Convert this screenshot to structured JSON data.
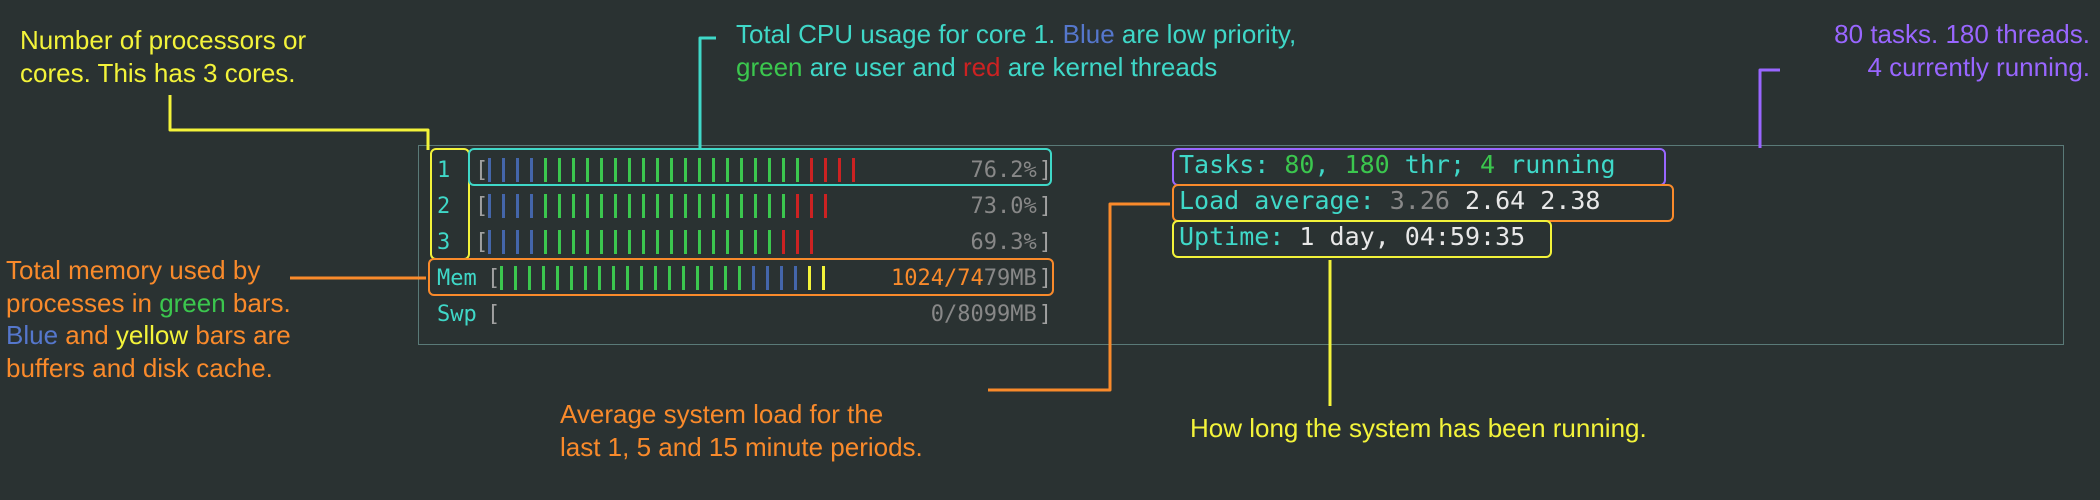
{
  "annotations": {
    "cores": {
      "line1": "Number of processors or",
      "line2": "cores. This has 3 cores."
    },
    "cpu": {
      "line1_a": "Total CPU usage for core 1. ",
      "line1_blue": "Blue",
      "line1_b": " are low priority,",
      "line2_green": "green",
      "line2_a": " are user and ",
      "line2_red": "red",
      "line2_b": " are kernel threads"
    },
    "tasks": {
      "line1": "80 tasks. 180 threads.",
      "line2": "4 currently running."
    },
    "mem": {
      "line1_a": "Total memory used by",
      "line2_a": "processes in ",
      "line2_green": "green",
      "line2_b": " bars.",
      "line3_blue": "Blue",
      "line3_a": " and ",
      "line3_yellow": "yellow",
      "line3_b": " bars are",
      "line4": "buffers  and disk cache."
    },
    "load": {
      "line1": "Average system load for the",
      "line2": "last 1, 5 and 15 minute periods."
    },
    "uptime": {
      "line1": "How long the system has been running."
    }
  },
  "cpu": [
    {
      "label": "1",
      "pct": "76.2%",
      "bars": [
        "blue",
        "blue",
        "blue",
        "blue",
        "green",
        "green",
        "green",
        "green",
        "green",
        "green",
        "green",
        "green",
        "green",
        "green",
        "green",
        "green",
        "green",
        "green",
        "green",
        "green",
        "green",
        "green",
        "green",
        "red",
        "red",
        "red",
        "red"
      ]
    },
    {
      "label": "2",
      "pct": "73.0%",
      "bars": [
        "blue",
        "blue",
        "blue",
        "blue",
        "green",
        "green",
        "green",
        "green",
        "green",
        "green",
        "green",
        "green",
        "green",
        "green",
        "green",
        "green",
        "green",
        "green",
        "green",
        "green",
        "green",
        "green",
        "red",
        "red",
        "red"
      ]
    },
    {
      "label": "3",
      "pct": "69.3%",
      "bars": [
        "blue",
        "blue",
        "blue",
        "blue",
        "green",
        "green",
        "green",
        "green",
        "green",
        "green",
        "green",
        "green",
        "green",
        "green",
        "green",
        "green",
        "green",
        "green",
        "green",
        "green",
        "green",
        "red",
        "red",
        "red"
      ]
    }
  ],
  "mem": {
    "label": "Mem",
    "used": "1024/74",
    "total_grey": "79MB",
    "bars": [
      "green",
      "green",
      "green",
      "green",
      "green",
      "green",
      "green",
      "green",
      "green",
      "green",
      "green",
      "green",
      "green",
      "green",
      "green",
      "green",
      "green",
      "green",
      "blue",
      "blue",
      "blue",
      "blue",
      "yellow",
      "yellow"
    ]
  },
  "swp": {
    "label": "Swp",
    "value": "0/8099MB"
  },
  "tasks": {
    "label": "Tasks: ",
    "count": "80",
    "sep": ", ",
    "thr": "180",
    "thr_label": " thr; ",
    "run": "4",
    "run_label": " running"
  },
  "load": {
    "label": "Load average: ",
    "v1": "3.26",
    "v2": "2.64",
    "v3": "2.38"
  },
  "uptime": {
    "label": "Uptime: ",
    "value": "1 day, 04:59:35"
  }
}
